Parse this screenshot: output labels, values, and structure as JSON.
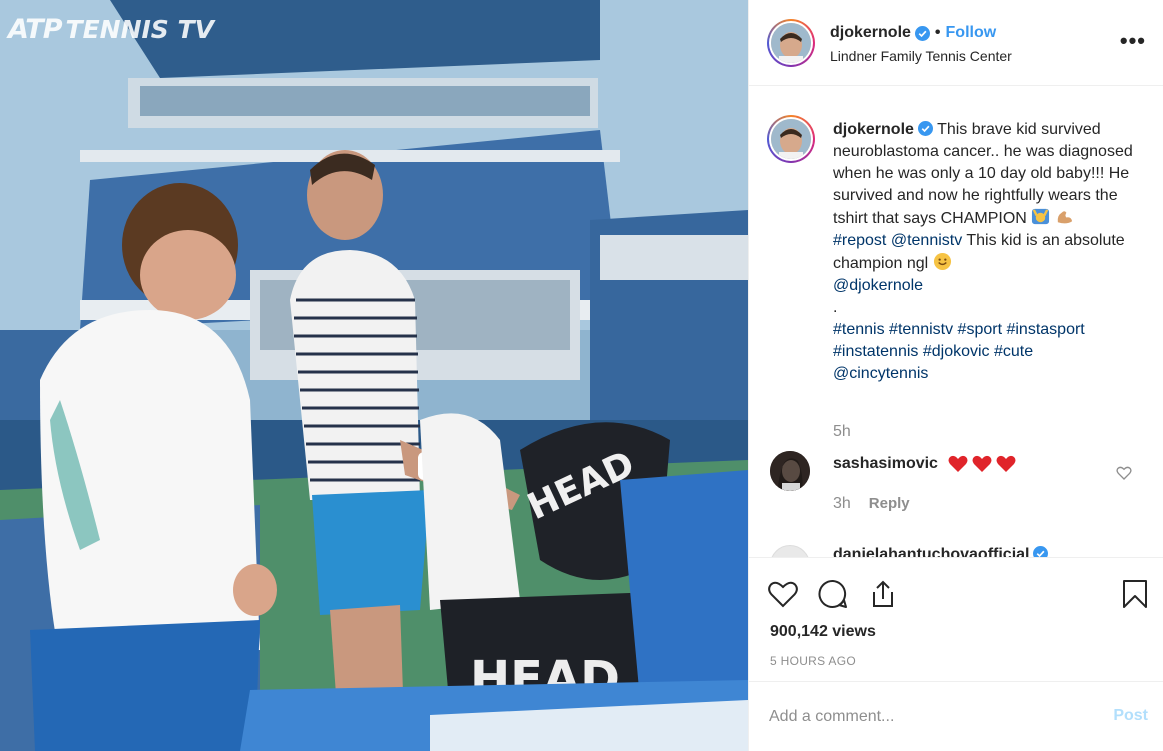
{
  "video": {
    "watermark_part1": "ATP",
    "watermark_part2": "TENNIS TV"
  },
  "post": {
    "author": "djokernole",
    "follow_label": "Follow",
    "location": "Lindner Family Tennis Center",
    "more_label": "•••",
    "caption": {
      "username": "djokernole",
      "line1": "This brave kid survived neuroblastoma cancer.. he was diagnosed when he was only a 10 day old baby!!! He survived and now he rightfully wears the tshirt that says CHAMPION",
      "repost_tag": "#repost",
      "repost_user": "@tennistv",
      "line2": "This kid is an absolute champion ngl",
      "mention": "@djokernole",
      "dot": ".",
      "hashtags": [
        "#tennis",
        "#tennistv",
        "#sport",
        "#instasport",
        "#instatennis",
        "#djokovic",
        "#cute"
      ],
      "mention2": "@cincytennis"
    },
    "caption_time": "5h",
    "comments": [
      {
        "username": "sashasimovic",
        "text": "❤❤❤",
        "time": "3h",
        "reply_label": "Reply"
      },
      {
        "username": "danielahantuchovaofficial",
        "text": ""
      }
    ],
    "views": "900,142 views",
    "posted_ago": "5 HOURS AGO",
    "comment_placeholder": "Add a comment...",
    "post_label": "Post"
  },
  "colors": {
    "link": "#3897f0",
    "hashtag": "#003569",
    "muted": "#8e8e8e",
    "heart": "#ed4956",
    "post_disabled": "#b2dffc"
  },
  "icons": [
    "verified-icon",
    "more-icon",
    "heart-icon",
    "comment-icon",
    "share-icon",
    "bookmark-icon",
    "like-comment-icon"
  ]
}
